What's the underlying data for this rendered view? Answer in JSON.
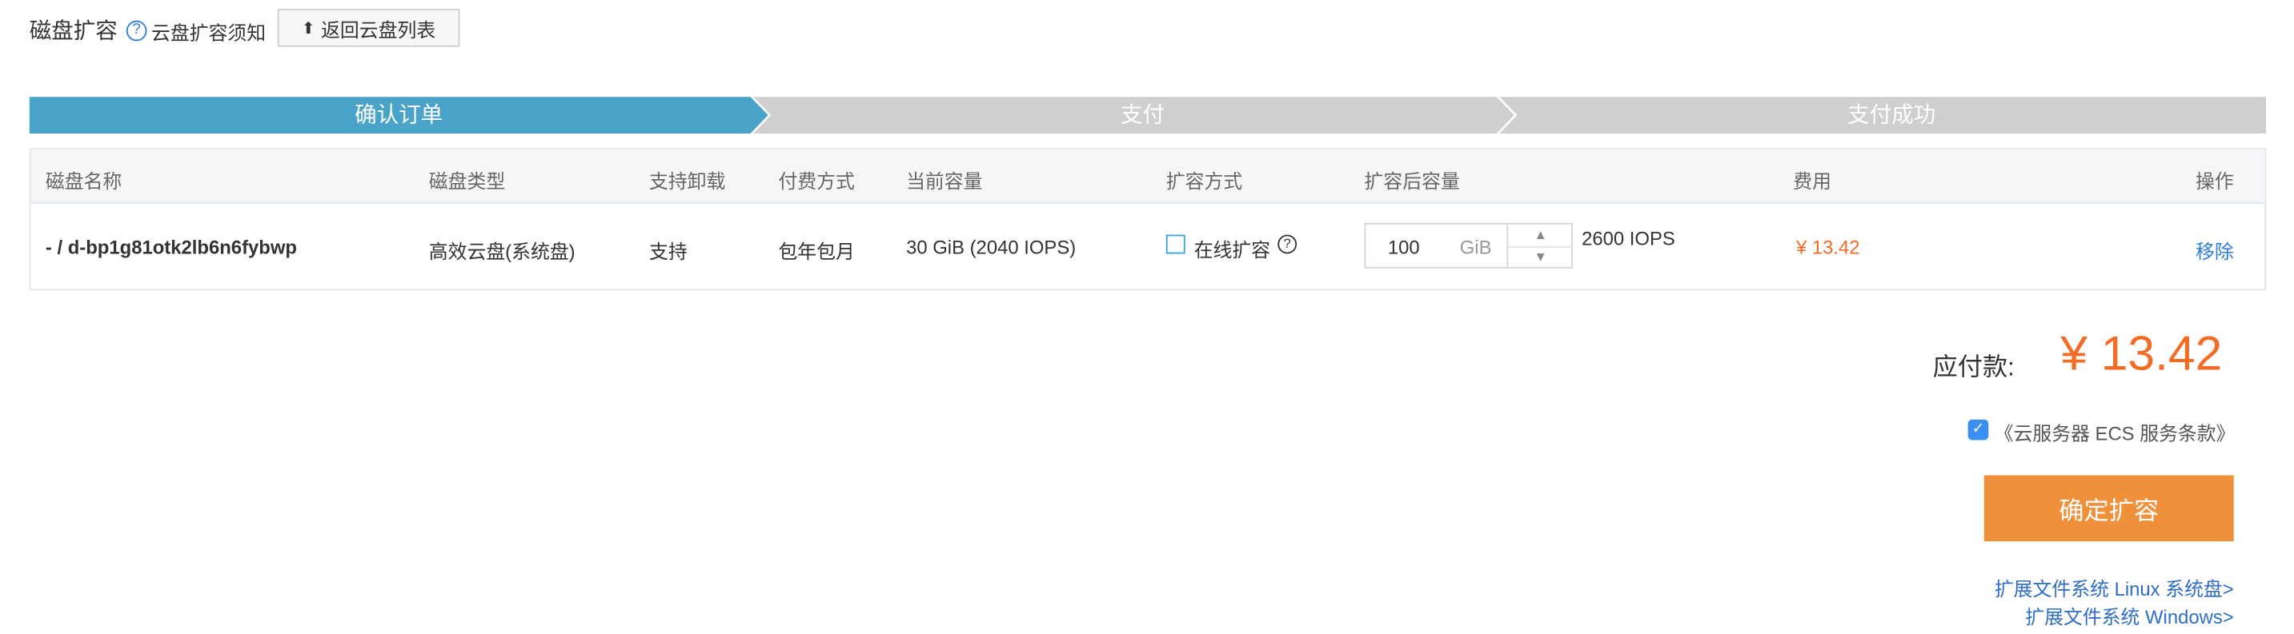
{
  "header": {
    "title": "磁盘扩容",
    "help_icon": "?",
    "help_link": "云盘扩容须知",
    "back_button": "返回云盘列表",
    "back_icon": "⬆"
  },
  "steps": [
    {
      "label": "确认订单",
      "active": true
    },
    {
      "label": "支付",
      "active": false
    },
    {
      "label": "支付成功",
      "active": false
    }
  ],
  "colors": {
    "step_active": "#4aa3c8",
    "step_inactive": "#cfcfcf",
    "accent_orange": "#f46b23",
    "button_orange": "#f0903a",
    "link_blue": "#2f6dc6"
  },
  "table": {
    "columns": {
      "name": "磁盘名称",
      "type": "磁盘类型",
      "detach": "支持卸载",
      "billing": "付费方式",
      "current": "当前容量",
      "method": "扩容方式",
      "new_capacity": "扩容后容量",
      "fee": "费用",
      "action": "操作"
    },
    "row": {
      "name": "- / d-bp1g81otk2lb6n6fybwp",
      "type": "高效云盘(系统盘)",
      "detach": "支持",
      "billing": "包年包月",
      "current": "30 GiB (2040 IOPS)",
      "method_label": "在线扩容",
      "method_checked": false,
      "method_help": "?",
      "capacity_value": "100",
      "capacity_unit": "GiB",
      "iops": "2600 IOPS",
      "fee": "¥ 13.42",
      "action": "移除"
    }
  },
  "summary": {
    "total_label": "应付款:",
    "total_amount": "¥ 13.42",
    "agreement_checked": true,
    "agreement_text": "《云服务器 ECS 服务条款》",
    "confirm_button": "确定扩容",
    "link_linux": "扩展文件系统 Linux 系统盘>",
    "link_windows": "扩展文件系统 Windows>"
  }
}
